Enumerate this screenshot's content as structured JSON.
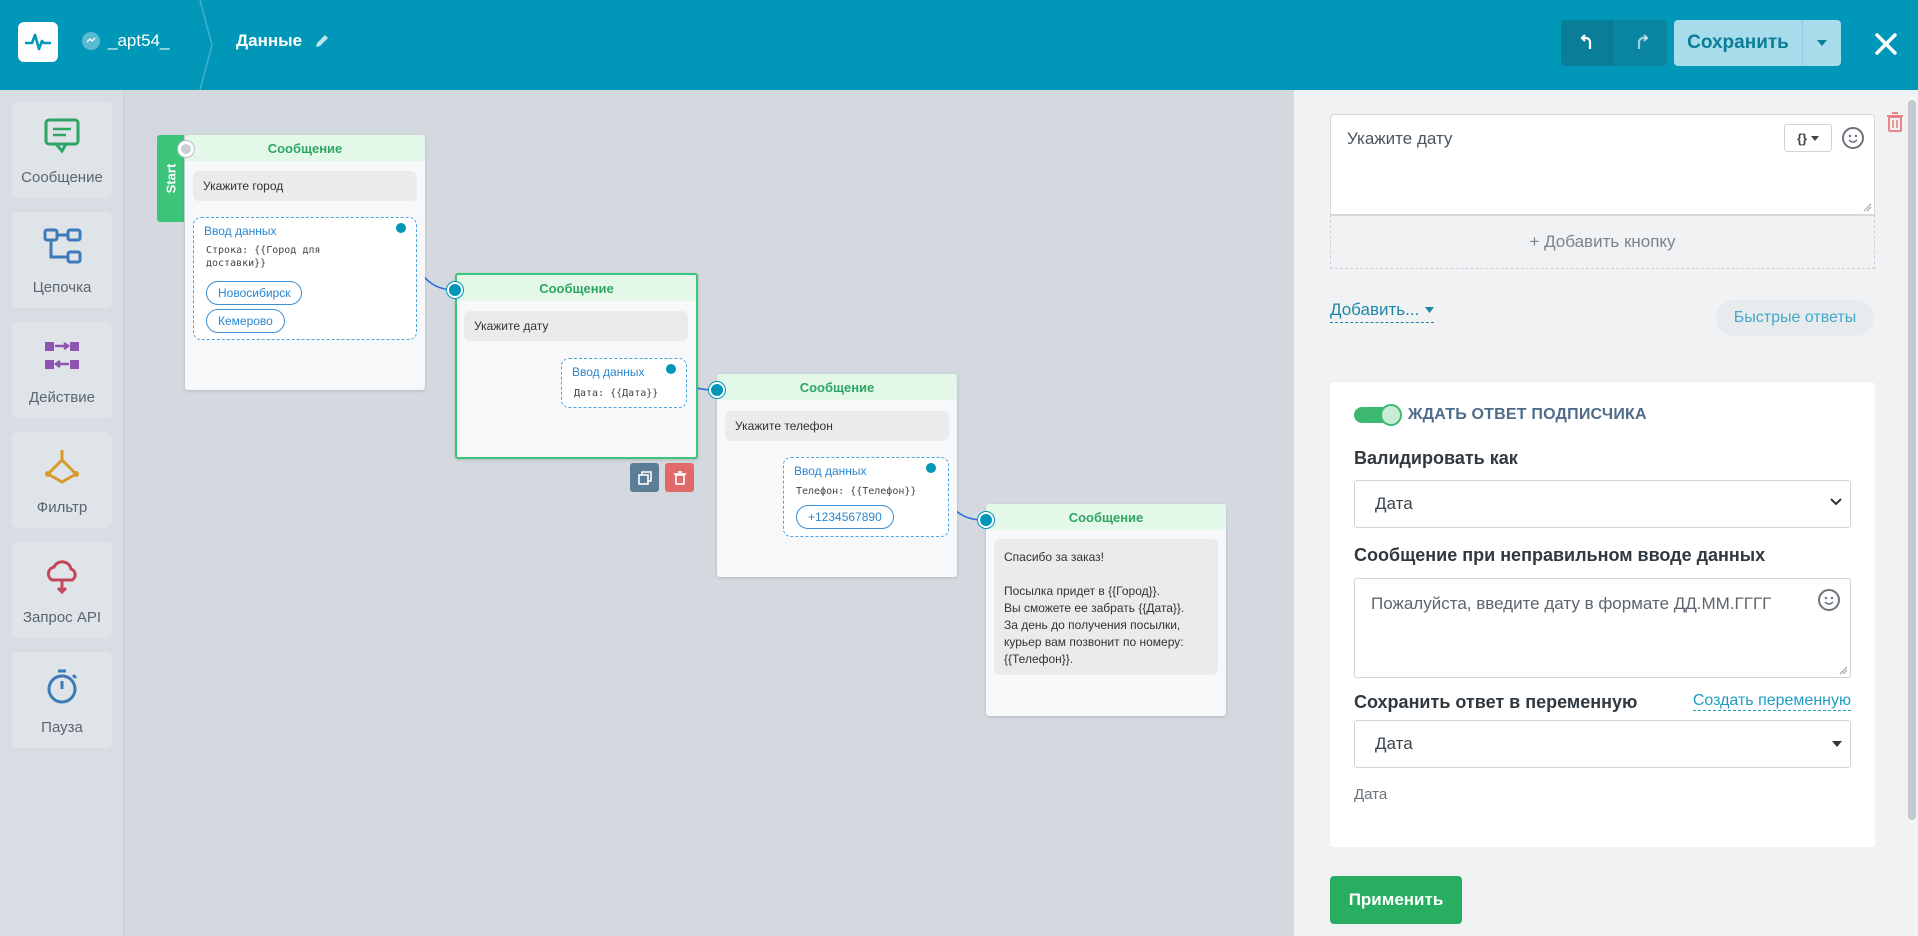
{
  "header": {
    "account_name": "_apt54_",
    "page_name": "Данные",
    "save_label": "Сохранить"
  },
  "palette": {
    "items": [
      {
        "label": "Сообщение",
        "icon": "message-icon",
        "color": "#2fa564"
      },
      {
        "label": "Цепочка",
        "icon": "chain-icon",
        "color": "#3d7ab8"
      },
      {
        "label": "Действие",
        "icon": "action-icon",
        "color": "#8e54b0"
      },
      {
        "label": "Фильтр",
        "icon": "filter-icon",
        "color": "#d99a2c"
      },
      {
        "label": "Запрос API",
        "icon": "api-cloud-icon",
        "color": "#c2475a"
      },
      {
        "label": "Пауза",
        "icon": "timer-icon",
        "color": "#3d7ab8"
      }
    ]
  },
  "canvas": {
    "start_label": "Start",
    "nodes": [
      {
        "title": "Сообщение",
        "text": "Укажите город",
        "input_title": "Ввод данных",
        "input_sub": "Строка: {{Город для\nдоставки}}",
        "chips": [
          "Новосибирск",
          "Кемерово"
        ]
      },
      {
        "title": "Сообщение",
        "text": "Укажите дату",
        "input_title": "Ввод данных",
        "input_sub": "Дата: {{Дата}}"
      },
      {
        "title": "Сообщение",
        "text": "Укажите телефон",
        "input_title": "Ввод данных",
        "input_sub": "Телефон: {{Телефон}}",
        "chips": [
          "+1234567890"
        ]
      },
      {
        "title": "Сообщение",
        "text": "Спасибо за заказ!\n\nПосылка придет в {{Город}}.\nВы сможете ее забрать {{Дата}}.\nЗа день до получения посылки,\nкурьер вам позвонит по номеру:\n{{Телефон}}."
      }
    ]
  },
  "panel": {
    "message_text": "Укажите дату",
    "var_button": "{}",
    "add_button": "+ Добавить кнопку",
    "add_dropdown": "Добавить...",
    "quick_replies": "Быстрые ответы",
    "wait_reply_label": "ЖДАТЬ ОТВЕТ ПОДПИСЧИКА",
    "wait_reply_on": true,
    "validate_label": "Валидировать как",
    "validate_value": "Дата",
    "invalid_label": "Сообщение при неправильном вводе данных",
    "invalid_text": "Пожалуйста, введите дату в формате ДД.ММ.ГГГГ",
    "save_var_label": "Сохранить ответ в переменную",
    "create_var": "Создать переменную",
    "save_var_value": "Дата",
    "save_var_hint": "Дата",
    "apply": "Применить"
  },
  "colors": {
    "header": "#0097b9",
    "accent_green": "#27ae60",
    "link_blue": "#1f86a6"
  }
}
